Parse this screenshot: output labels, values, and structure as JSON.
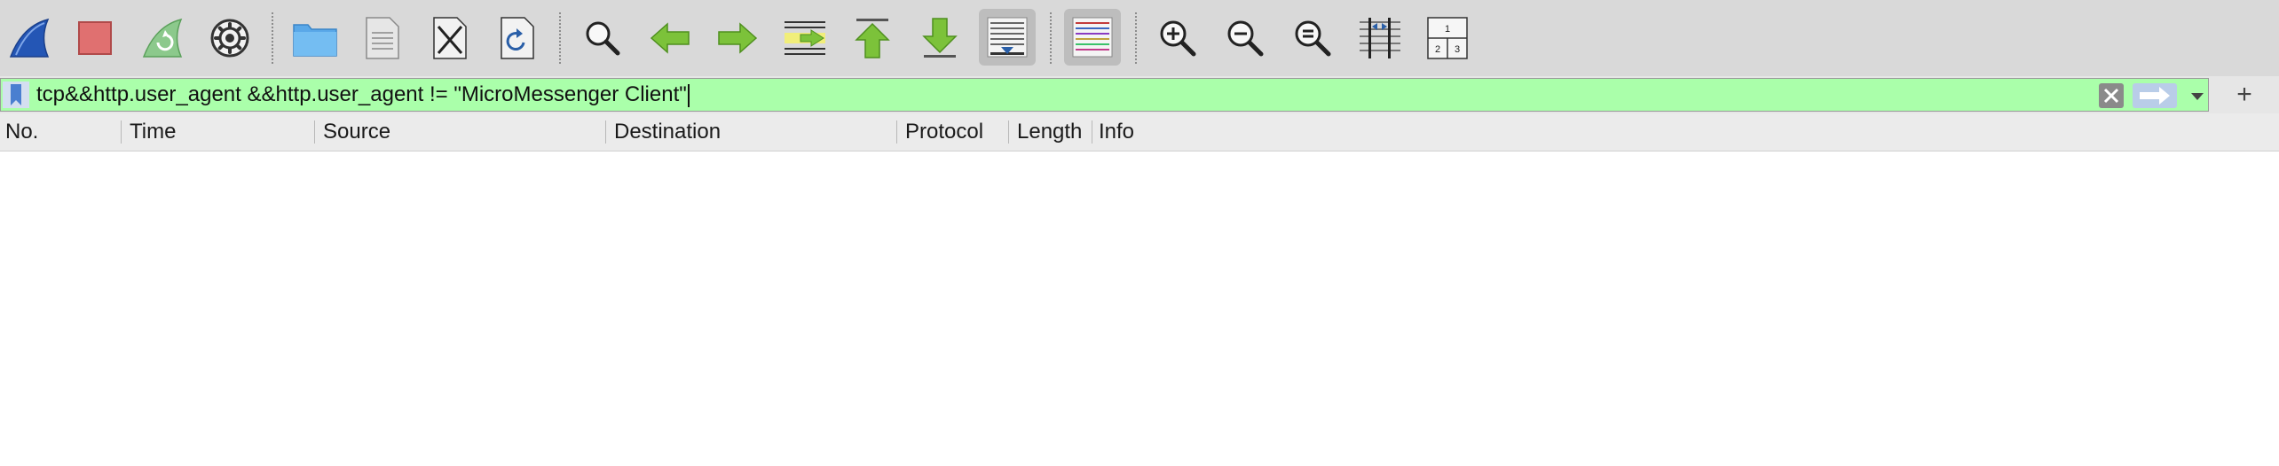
{
  "toolbar": {
    "buttons": [
      {
        "name": "start-capture-icon",
        "active": false
      },
      {
        "name": "stop-capture-icon",
        "active": false
      },
      {
        "name": "restart-capture-icon",
        "active": false
      },
      {
        "name": "capture-options-icon",
        "active": false
      },
      {
        "name": "open-file-icon",
        "active": false
      },
      {
        "name": "save-file-icon",
        "active": false
      },
      {
        "name": "close-file-icon",
        "active": false
      },
      {
        "name": "reload-file-icon",
        "active": false
      },
      {
        "name": "find-packet-icon",
        "active": false
      },
      {
        "name": "go-back-icon",
        "active": false
      },
      {
        "name": "go-forward-icon",
        "active": false
      },
      {
        "name": "go-to-packet-icon",
        "active": false
      },
      {
        "name": "go-first-packet-icon",
        "active": false
      },
      {
        "name": "go-last-packet-icon",
        "active": false
      },
      {
        "name": "auto-scroll-icon",
        "active": true
      },
      {
        "name": "colorize-icon",
        "active": true
      },
      {
        "name": "zoom-in-icon",
        "active": false
      },
      {
        "name": "zoom-out-icon",
        "active": false
      },
      {
        "name": "zoom-normal-icon",
        "active": false
      },
      {
        "name": "resize-columns-icon",
        "active": false
      },
      {
        "name": "layout-panes-icon",
        "active": false
      }
    ],
    "layout_numbers": [
      "1",
      "2",
      "3"
    ]
  },
  "filter": {
    "value": "tcp&&http.user_agent &&http.user_agent != \"MicroMessenger Client\"",
    "background": "#aaffaa",
    "add_label": "+"
  },
  "columns": {
    "no": "No.",
    "time": "Time",
    "source": "Source",
    "destination": "Destination",
    "protocol": "Protocol",
    "length": "Length",
    "info": "Info"
  },
  "packets": []
}
